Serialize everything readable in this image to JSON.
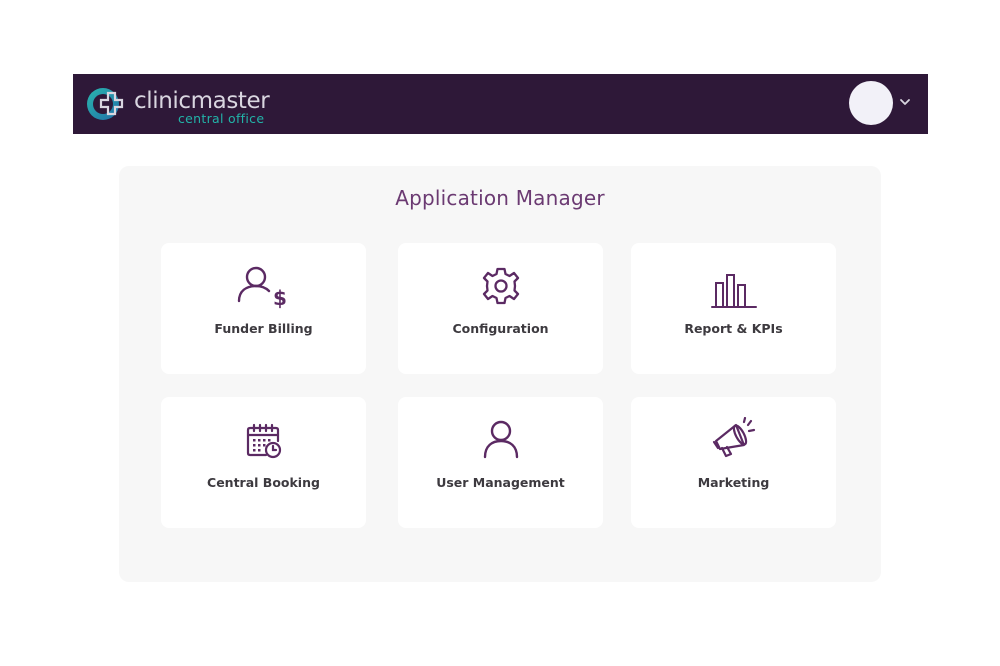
{
  "header": {
    "brand_name": "clinicmaster",
    "brand_subtitle": "central office",
    "logo_icon": "cross-logo-icon",
    "avatar_icon": "avatar",
    "menu_icon": "chevron-down-icon",
    "colors": {
      "bar": "#2e1838",
      "brand_text": "#d9d6e0",
      "accent_teal": "#22b3a8"
    }
  },
  "main": {
    "title": "Application Manager",
    "title_color": "#6b3a72",
    "icon_color": "#5b2a63",
    "apps": [
      {
        "label": "Funder Billing",
        "icon": "user-dollar-icon"
      },
      {
        "label": "Configuration",
        "icon": "gear-icon"
      },
      {
        "label": "Report & KPIs",
        "icon": "bar-chart-icon"
      },
      {
        "label": "Central Booking",
        "icon": "calendar-clock-icon"
      },
      {
        "label": "User Management",
        "icon": "user-icon"
      },
      {
        "label": "Marketing",
        "icon": "megaphone-icon"
      }
    ]
  }
}
